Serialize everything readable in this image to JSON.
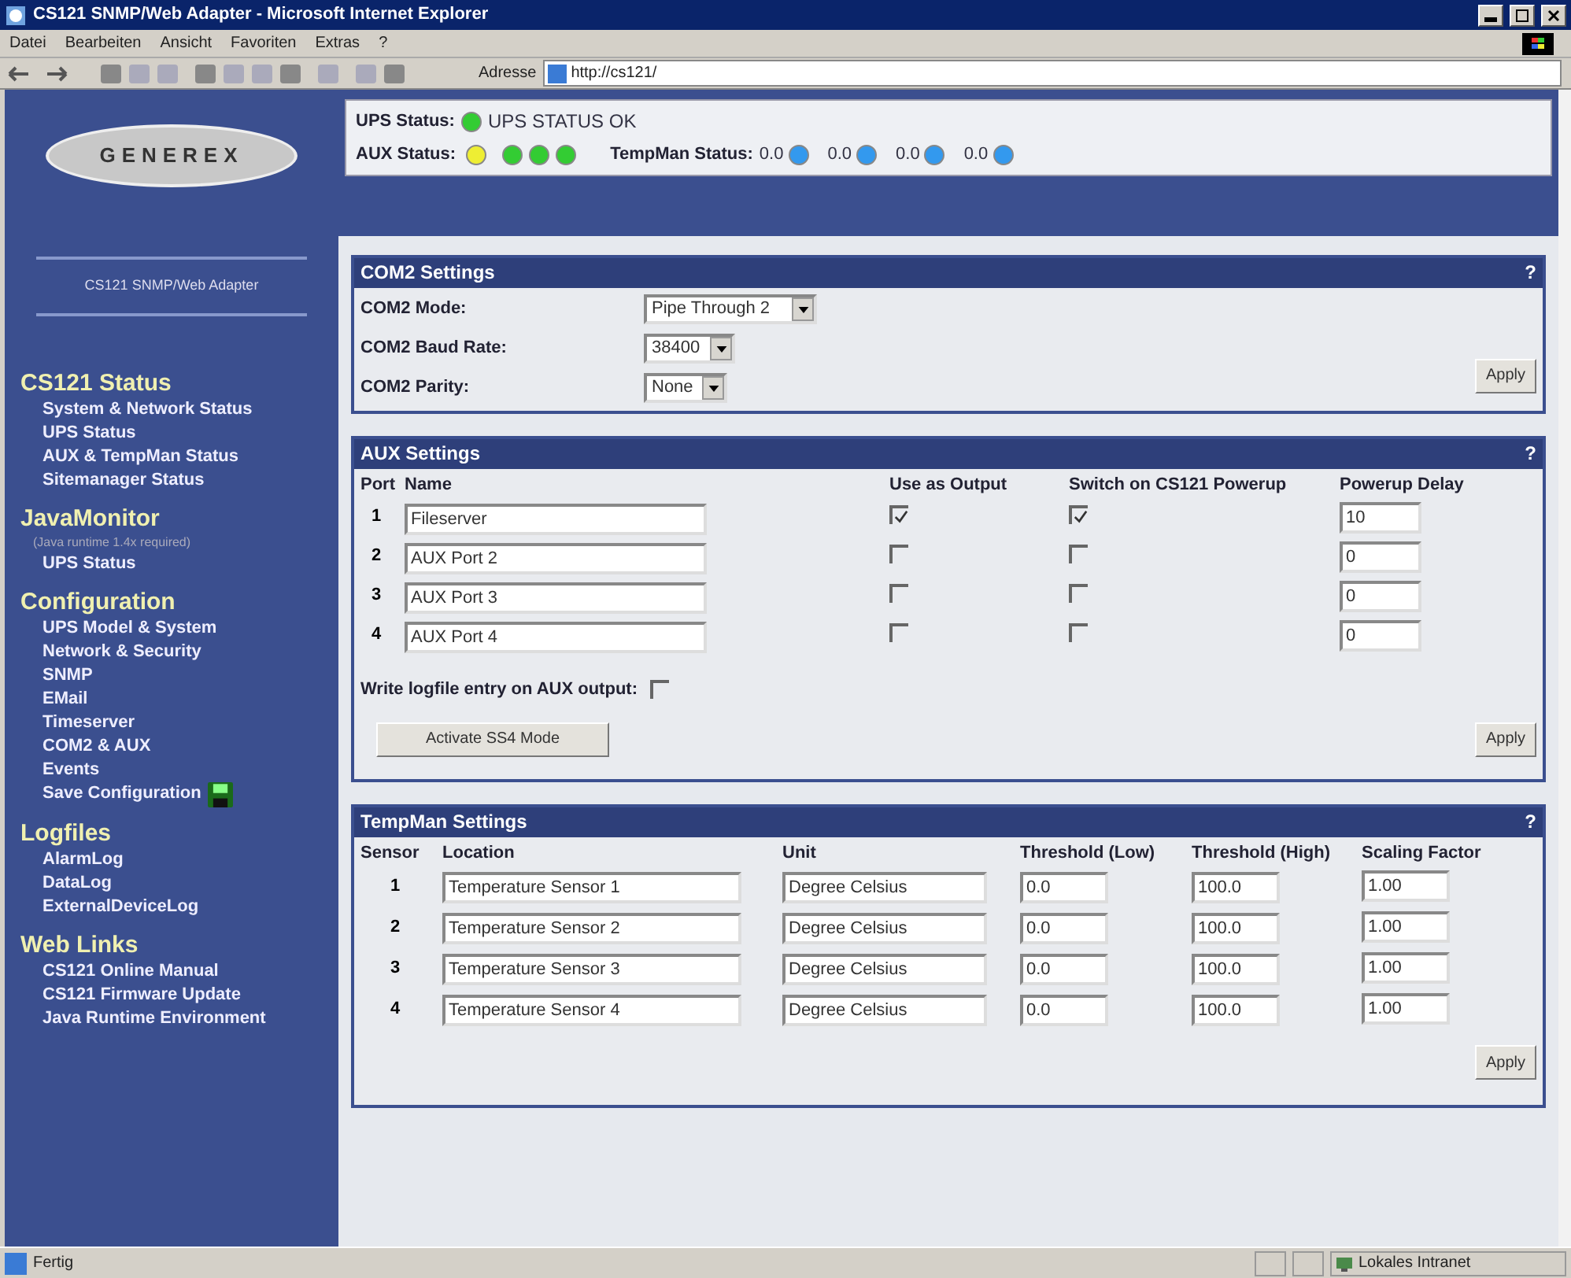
{
  "window": {
    "title": "CS121 SNMP/Web Adapter - Microsoft Internet Explorer"
  },
  "menu": [
    "Datei",
    "Bearbeiten",
    "Ansicht",
    "Favoriten",
    "Extras",
    "?"
  ],
  "address": {
    "label": "Adresse",
    "value": "http://cs121/"
  },
  "sidebar": {
    "logo": "GENEREX",
    "subtitle": "CS121 SNMP/Web Adapter",
    "sections": [
      {
        "title": "CS121 Status",
        "items": [
          "System & Network Status",
          "UPS Status",
          "AUX & TempMan Status",
          "Sitemanager Status"
        ]
      },
      {
        "title": "JavaMonitor",
        "note": "(Java runtime 1.4x required)",
        "items": [
          "UPS Status"
        ]
      },
      {
        "title": "Configuration",
        "items": [
          "UPS Model & System",
          "Network & Security",
          "SNMP",
          "EMail",
          "Timeserver",
          "COM2 & AUX",
          "Events",
          "Save Configuration"
        ],
        "save_icon": true
      },
      {
        "title": "Logfiles",
        "items": [
          "AlarmLog",
          "DataLog",
          "ExternalDeviceLog"
        ]
      },
      {
        "title": "Web Links",
        "items": [
          "CS121 Online Manual",
          "CS121 Firmware Update",
          "Java Runtime Environment"
        ]
      }
    ]
  },
  "status": {
    "ups_label": "UPS Status:",
    "ups_dots": [
      {
        "color": "#33cc33"
      }
    ],
    "ups_text": "UPS STATUS OK",
    "aux_label": "AUX Status:",
    "aux": [
      {
        "color": "#eeee33"
      },
      {
        "color": "#33cc33"
      },
      {
        "color": "#33cc33"
      },
      {
        "color": "#33cc33"
      }
    ],
    "tempman_label": "TempMan Status:",
    "tempman": [
      {
        "value": "0.0",
        "color": "#3399ee"
      },
      {
        "value": "0.0",
        "color": "#3399ee"
      },
      {
        "value": "0.0",
        "color": "#3399ee"
      },
      {
        "value": "0.0",
        "color": "#3399ee"
      }
    ]
  },
  "com2": {
    "title": "COM2 Settings",
    "help": "?",
    "fields": [
      {
        "label": "COM2 Mode:",
        "value": "Pipe Through 2"
      },
      {
        "label": "COM2 Baud Rate:",
        "value": "38400"
      },
      {
        "label": "COM2 Parity:",
        "value": "None"
      }
    ],
    "apply": "Apply"
  },
  "aux": {
    "title": "AUX Settings",
    "help": "?",
    "columns": [
      "Port",
      "Name",
      "Use as Output",
      "Switch on CS121 Powerup",
      "Powerup Delay"
    ],
    "rows": [
      {
        "port": "1",
        "name": "Fileserver",
        "output": true,
        "powerup": true,
        "delay": "10"
      },
      {
        "port": "2",
        "name": "AUX Port 2",
        "output": false,
        "powerup": false,
        "delay": "0"
      },
      {
        "port": "3",
        "name": "AUX Port 3",
        "output": false,
        "powerup": false,
        "delay": "0"
      },
      {
        "port": "4",
        "name": "AUX Port 4",
        "output": false,
        "powerup": false,
        "delay": "0"
      }
    ],
    "logfile_label": "Write logfile entry on AUX output:",
    "logfile_checked": false,
    "activate": "Activate SS4 Mode",
    "apply": "Apply"
  },
  "tempman": {
    "title": "TempMan Settings",
    "help": "?",
    "columns": [
      "Sensor",
      "Location",
      "Unit",
      "Threshold (Low)",
      "Threshold (High)",
      "Scaling Factor"
    ],
    "rows": [
      {
        "sensor": "1",
        "location": "Temperature Sensor 1",
        "unit": "Degree Celsius",
        "low": "0.0",
        "high": "100.0",
        "scale": "1.00"
      },
      {
        "sensor": "2",
        "location": "Temperature Sensor 2",
        "unit": "Degree Celsius",
        "low": "0.0",
        "high": "100.0",
        "scale": "1.00"
      },
      {
        "sensor": "3",
        "location": "Temperature Sensor 3",
        "unit": "Degree Celsius",
        "low": "0.0",
        "high": "100.0",
        "scale": "1.00"
      },
      {
        "sensor": "4",
        "location": "Temperature Sensor 4",
        "unit": "Degree Celsius",
        "low": "0.0",
        "high": "100.0",
        "scale": "1.00"
      }
    ],
    "apply": "Apply"
  },
  "status_bar": {
    "text": "Fertig",
    "zone": "Lokales Intranet"
  }
}
